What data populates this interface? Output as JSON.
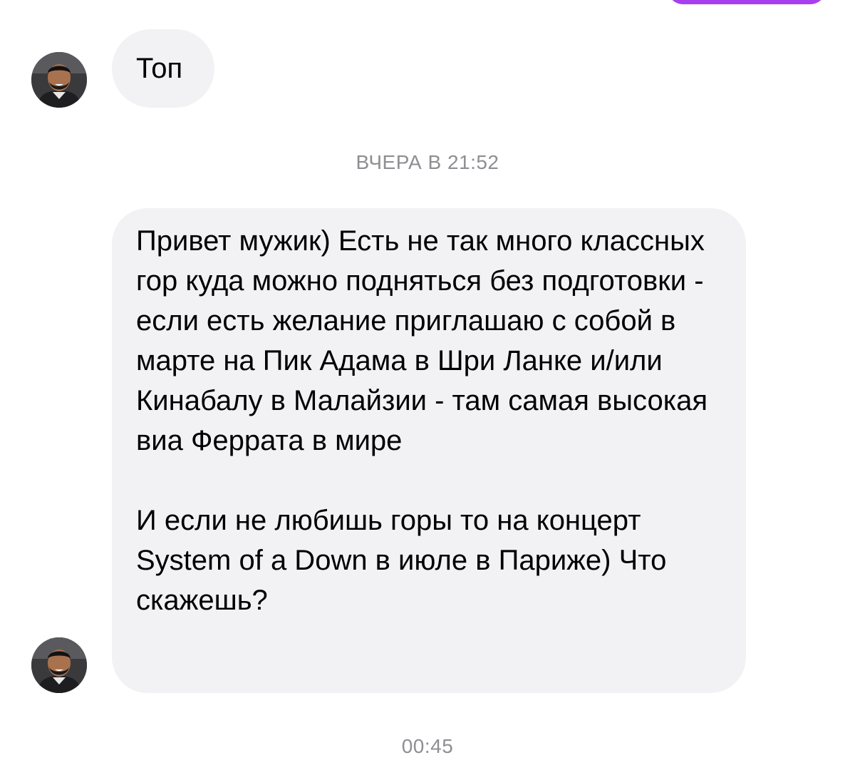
{
  "colors": {
    "background": "#ffffff",
    "received_bubble": "#f2f2f4",
    "sent_bubble": "#a93df0",
    "timestamp_text": "#8e8e93"
  },
  "messages": [
    {
      "type": "received",
      "avatar_icon": "user-avatar-icon",
      "text": "Топ"
    },
    {
      "type": "timestamp",
      "text": "ВЧЕРА В 21:52"
    },
    {
      "type": "received",
      "avatar_icon": "user-avatar-icon",
      "paragraphs": [
        "Привет мужик) Есть не так много классных гор куда можно подняться без подготовки - если есть желание приглашаю с собой в марте на Пик Адама в Шри Ланке и/или Кинабалу в Малайзии - там самая высокая виа Феррата в мире",
        "И если не любишь горы то на концерт System of a Down в июле в Париже) Что скажешь?"
      ]
    },
    {
      "type": "timestamp",
      "text": "00:45"
    }
  ]
}
